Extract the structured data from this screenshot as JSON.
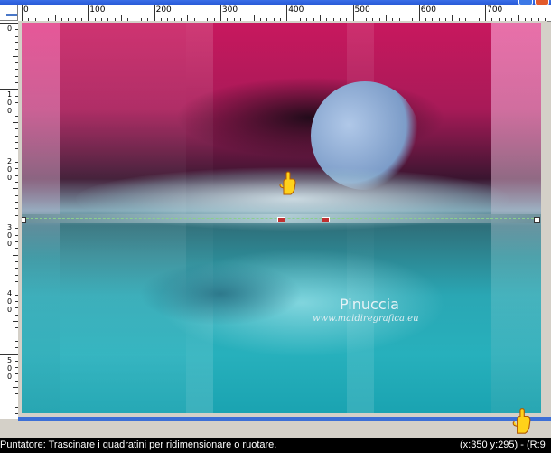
{
  "ruler": {
    "h_labels": [
      "0",
      "100",
      "200",
      "300",
      "400",
      "500",
      "600",
      "700"
    ],
    "v_labels": [
      [
        "0"
      ],
      [
        "1",
        "0",
        "0"
      ],
      [
        "2",
        "0",
        "0"
      ],
      [
        "3",
        "0",
        "0"
      ],
      [
        "4",
        "0",
        "0"
      ],
      [
        "5",
        "0",
        "0"
      ]
    ]
  },
  "image": {
    "watermark_title": "Pinuccia",
    "watermark_url": "www.maidiregrafica.eu"
  },
  "status": {
    "hint": "Puntatore: Trascinare i quadratini per ridimensionare o ruotare.",
    "coords": "(x:350 y:295) - (R:9"
  },
  "colors": {
    "accent": "#3c6fd6",
    "pink": "#c8185e",
    "teal": "#27b0bc",
    "guide": "#8cd08c"
  },
  "icons": [
    "pointer-hand-icon",
    "window-close-icon",
    "window-maximize-icon"
  ]
}
